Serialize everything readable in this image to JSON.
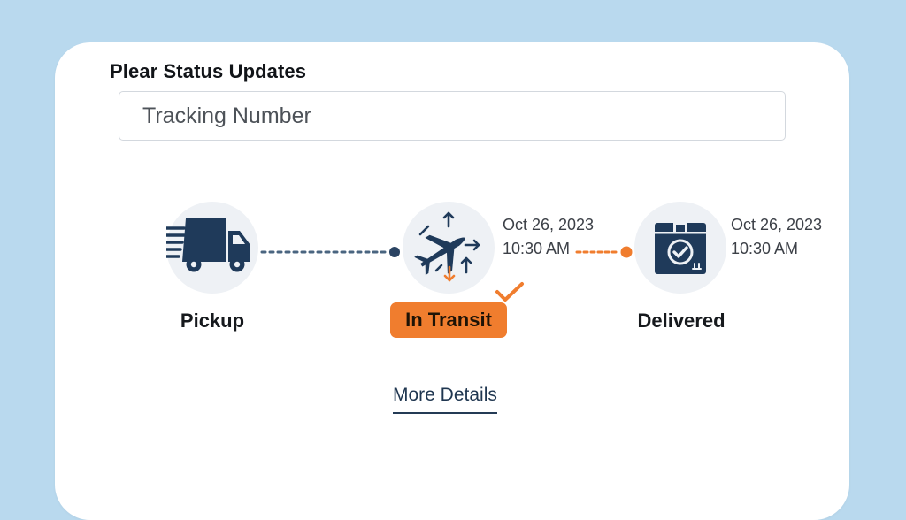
{
  "header": {
    "title": "Plear Status Updates"
  },
  "search": {
    "placeholder": "Tracking Number",
    "value": ""
  },
  "steps": [
    {
      "label": "Pickup",
      "icon": "delivery-truck-icon",
      "status": "completed"
    },
    {
      "label": "In Transit",
      "icon": "airplane-transit-icon",
      "status": "current",
      "date": "Oct 26, 2023",
      "time": "10:30 AM"
    },
    {
      "label": "Delivered",
      "icon": "package-check-icon",
      "status": "upcoming",
      "date": "Oct 26, 2023",
      "time": "10:30 AM"
    }
  ],
  "links": {
    "more_details": "More Details"
  },
  "colors": {
    "background": "#b9d9ee",
    "accent": "#f07d2e",
    "navy": "#1f3a5a",
    "icon_bg": "#eef1f5"
  }
}
